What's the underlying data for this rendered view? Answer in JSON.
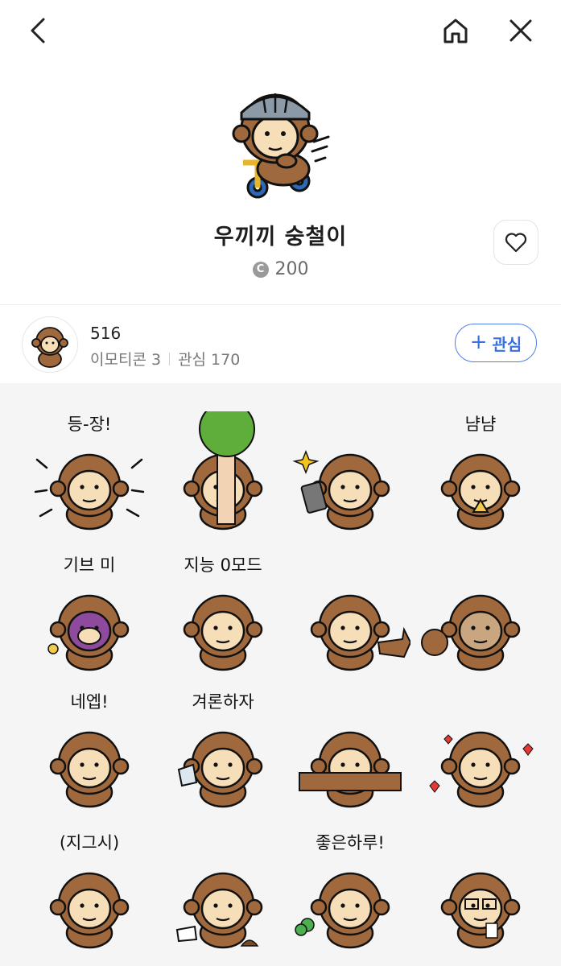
{
  "header": {
    "back_icon": "chevron-left-icon",
    "home_icon": "home-icon",
    "close_icon": "close-icon"
  },
  "product": {
    "title": "우끼끼 숭철이",
    "price_icon": "coin-icon",
    "coin_symbol": "C",
    "price": "200",
    "like_icon": "heart-icon"
  },
  "author": {
    "name": "516",
    "emoticon_count": "이모티콘 3",
    "follower_count": "관심 170",
    "follow_label": "관심",
    "follow_icon": "plus-icon"
  },
  "emoticons": {
    "captions": [
      "등-장!",
      "",
      "",
      "냠냠",
      "기브 미",
      "지능 0모드",
      "",
      "",
      "네엡!",
      "겨론하자",
      "",
      "",
      "(지그시)",
      "",
      "좋은하루!",
      ""
    ]
  },
  "colors": {
    "accent_blue": "#3a6fe0",
    "monkey_brown": "#a0693d",
    "monkey_face": "#f6deb8",
    "grid_background": "#f5f5f5"
  }
}
